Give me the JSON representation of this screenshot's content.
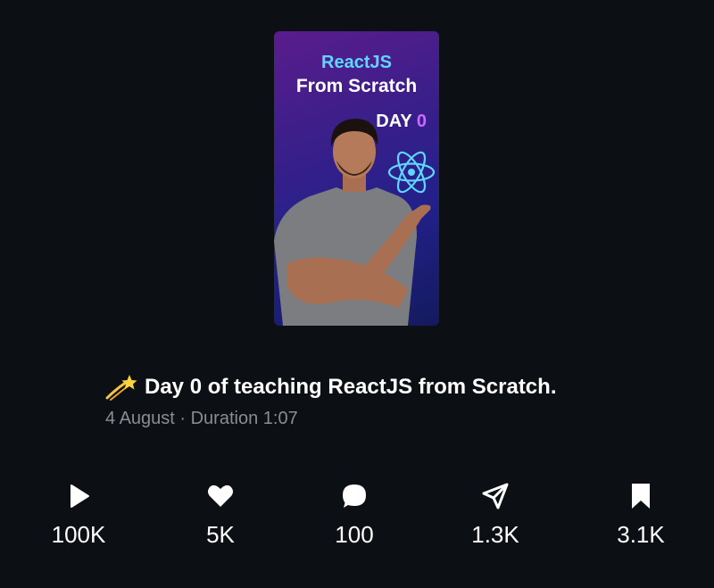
{
  "thumbnail": {
    "title_line1": "ReactJS",
    "title_line2": "From Scratch",
    "day_label": "DAY",
    "day_number": "0",
    "accent_cyan": "#5fd6ff",
    "accent_purple": "#c86bff",
    "logo_icon": "react-atom-icon"
  },
  "caption": {
    "emoji_icon": "dizzy-star-icon",
    "text": "Day 0 of teaching ReactJS from Scratch."
  },
  "meta": {
    "text": "4 August · Duration 1:07"
  },
  "stats": {
    "views": {
      "icon": "play-icon",
      "count": "100K"
    },
    "likes": {
      "icon": "heart-icon",
      "count": "5K"
    },
    "comments": {
      "icon": "comment-icon",
      "count": "100"
    },
    "shares": {
      "icon": "send-icon",
      "count": "1.3K"
    },
    "saves": {
      "icon": "bookmark-icon",
      "count": "3.1K"
    }
  }
}
